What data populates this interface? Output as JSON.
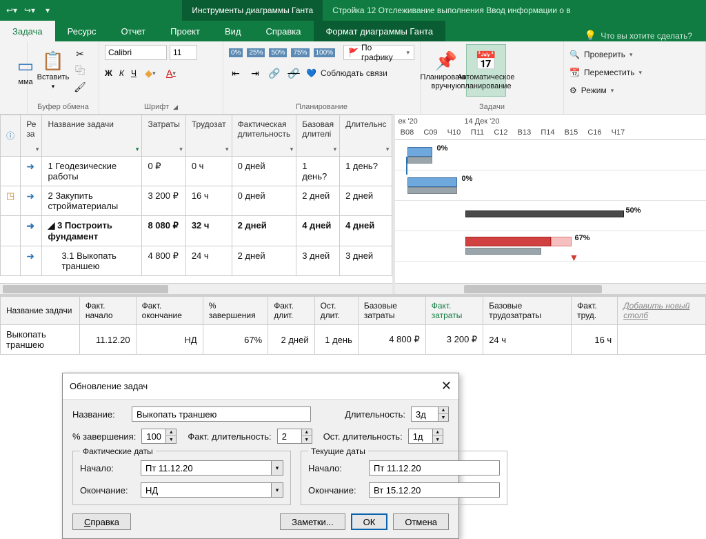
{
  "qat": {
    "undo": "↩",
    "redo": "↪"
  },
  "context_tabs": [
    "Инструменты диаграммы Ганта"
  ],
  "doc_title": "Стройка 12 Отслеживание выполнения Ввод информации о в",
  "tabs": [
    "Задача",
    "Ресурс",
    "Отчет",
    "Проект",
    "Вид",
    "Справка",
    "Формат диаграммы Ганта"
  ],
  "tell_me": "Что вы хотите сделать?",
  "ribbon": {
    "clipboard": {
      "label": "Буфер обмена",
      "paste": "Вставить",
      "mma": "мма"
    },
    "font": {
      "label": "Шрифт",
      "name": "Calibri",
      "size": "11",
      "bold": "Ж",
      "italic": "К",
      "underline": "Ч"
    },
    "schedule": {
      "label": "Планирование",
      "on_schedule": "По графику",
      "respect_links": "Соблюдать связи"
    },
    "tasks_group": {
      "label": "Задачи",
      "manual": "Планирование вручную",
      "auto": "Автоматическое планирование"
    },
    "maintain": {
      "inspect": "Проверить",
      "move": "Переместить",
      "mode": "Режим"
    }
  },
  "columns": {
    "info": "ⓘ",
    "mode": "Ре за",
    "name": "Название задачи",
    "cost": "Затраты",
    "work": "Трудозат",
    "act_dur": "Фактическая длительность",
    "base_dur": "Базовая длителі",
    "dur": "Длительнс"
  },
  "rows": [
    {
      "num": "1",
      "name": "Геодезические работы",
      "cost": "0 ₽",
      "work": "0 ч",
      "act_dur": "0 дней",
      "base_dur": "1 день?",
      "dur": "1 день?",
      "pct": "0%"
    },
    {
      "num": "2",
      "name": "Закупить стройматериалы",
      "cost": "3 200 ₽",
      "work": "16 ч",
      "act_dur": "0 дней",
      "base_dur": "2 дней",
      "dur": "2 дней",
      "pct": "0%"
    },
    {
      "num": "3",
      "name": "Построить фундамент",
      "cost": "8 080 ₽",
      "work": "32 ч",
      "act_dur": "2 дней",
      "base_dur": "4 дней",
      "dur": "4 дней",
      "pct": "50%",
      "summary": true
    },
    {
      "num": "3.1",
      "name": "Выкопать траншею",
      "cost": "4 800 ₽",
      "work": "24 ч",
      "act_dur": "2 дней",
      "base_dur": "3 дней",
      "dur": "3 дней",
      "pct": "67%",
      "selected": true
    }
  ],
  "timescale": {
    "groups": [
      "ек '20",
      "14 Дек '20"
    ],
    "days": [
      "В08",
      "С09",
      "Ч10",
      "П11",
      "С12",
      "В13",
      "П14",
      "В15",
      "С16",
      "Ч17"
    ]
  },
  "tracking": {
    "headers": {
      "name": "Название задачи",
      "act_start": "Факт. начало",
      "act_finish": "Факт. окончание",
      "pct": "% завершения",
      "act_dur": "Факт. длит.",
      "rem_dur": "Ост. длит.",
      "base_cost": "Базовые затраты",
      "act_cost": "Факт. затраты",
      "base_work": "Базовые трудозатраты",
      "act_work": "Факт. труд.",
      "add": "Добавить новый столб"
    },
    "row": {
      "name": "Выкопать траншею",
      "act_start": "11.12.20",
      "act_finish": "НД",
      "pct": "67%",
      "act_dur": "2 дней",
      "rem_dur": "1 день",
      "base_cost": "4 800 ₽",
      "act_cost": "3 200 ₽",
      "base_work": "24 ч",
      "act_work": "16 ч"
    }
  },
  "dialog": {
    "title": "Обновление задач",
    "name_label": "Название:",
    "name": "Выкопать траншею",
    "dur_label": "Длительность:",
    "dur": "3д",
    "pct_label": "% завершения:",
    "pct": "100",
    "act_dur_label": "Факт. длительность:",
    "act_dur": "2",
    "rem_dur_label": "Ост. длительность:",
    "rem_dur": "1д",
    "actual_dates": "Фактические даты",
    "current_dates": "Текущие даты",
    "start_label": "Начало:",
    "finish_label": "Окончание:",
    "act_start": "Пт 11.12.20",
    "act_finish": "НД",
    "cur_start": "Пт 11.12.20",
    "cur_finish": "Вт 15.12.20",
    "help": "Справка",
    "notes": "Заметки...",
    "ok": "ОК",
    "cancel": "Отмена"
  }
}
